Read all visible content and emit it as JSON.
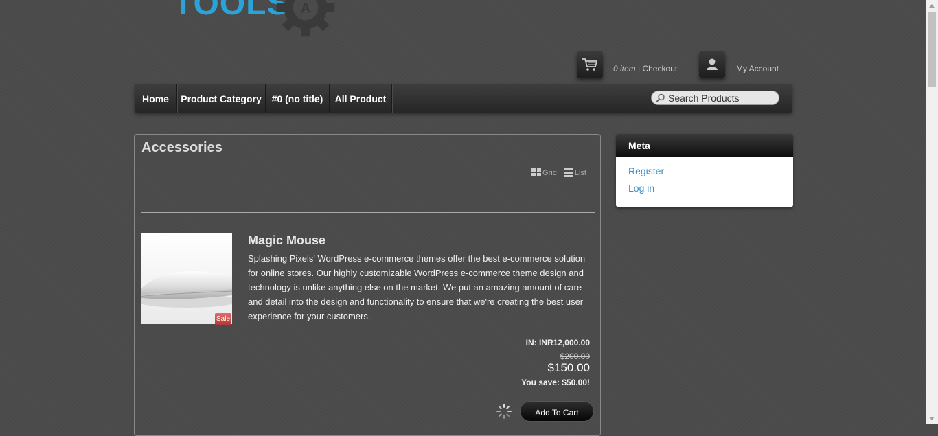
{
  "brand": {
    "logo_text": "TOOLS"
  },
  "header": {
    "cart_count": "0 item",
    "separator": "|",
    "checkout_label": "Checkout",
    "account_label": "My Account"
  },
  "nav": {
    "items": [
      {
        "label": "Home"
      },
      {
        "label": "Product Category"
      },
      {
        "label": "#0 (no title)"
      },
      {
        "label": "All Product"
      }
    ],
    "search_placeholder": "Search Products"
  },
  "main": {
    "title": "Accessories",
    "view_grid_label": "Grid",
    "view_list_label": "List",
    "product": {
      "title": "Magic Mouse",
      "description": "Splashing Pixels' WordPress e-commerce themes offer the best e-commerce solution for online stores. Our highly customizable WordPress e-commerce theme design and technology is unlike anything else on the market. We put an amazing amount of care and detail into the design and functionality to ensure that we're creating the best user experience for your customers.",
      "sale_badge": "Sale",
      "price_in": "IN: INR12,000.00",
      "old_price": "$200.00",
      "new_price": "$150.00",
      "you_save": "You save: $50.00!",
      "add_to_cart_label": "Add To Cart"
    }
  },
  "sidebar": {
    "title": "Meta",
    "links": [
      {
        "label": "Register"
      },
      {
        "label": "Log in"
      }
    ]
  },
  "colors": {
    "brand": "#2ba3d8",
    "link": "#3d8fc6",
    "background": "#4a4a4a"
  }
}
